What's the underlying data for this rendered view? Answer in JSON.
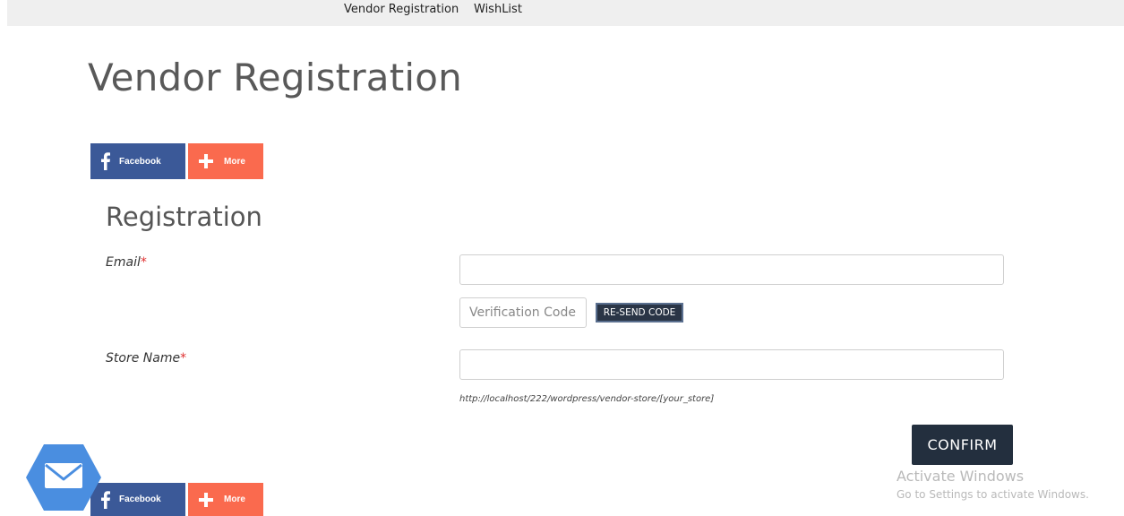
{
  "nav": {
    "items": [
      {
        "label": "Vendor Registration"
      },
      {
        "label": "WishList"
      }
    ]
  },
  "page": {
    "title": "Vendor Registration"
  },
  "share": {
    "facebook_label": "Facebook",
    "more_label": "More",
    "colors": {
      "facebook": "#3b5998",
      "more": "#fa6a4e"
    }
  },
  "form": {
    "title": "Registration",
    "email": {
      "label": "Email",
      "required_mark": "*",
      "value": ""
    },
    "verification": {
      "placeholder": "Verification Code",
      "resend_label": "RE-SEND CODE"
    },
    "store_name": {
      "label": "Store Name",
      "required_mark": "*",
      "value": ""
    },
    "store_url_hint": "http://localhost/222/wordpress/vendor-store/[your_store]",
    "confirm_label": "CONFIRM"
  },
  "watermark": {
    "line1": "Activate Windows",
    "line2": "Go to Settings to activate Windows."
  },
  "icons": {
    "facebook": "facebook-icon",
    "more": "plus-icon",
    "mail": "envelope-icon"
  }
}
